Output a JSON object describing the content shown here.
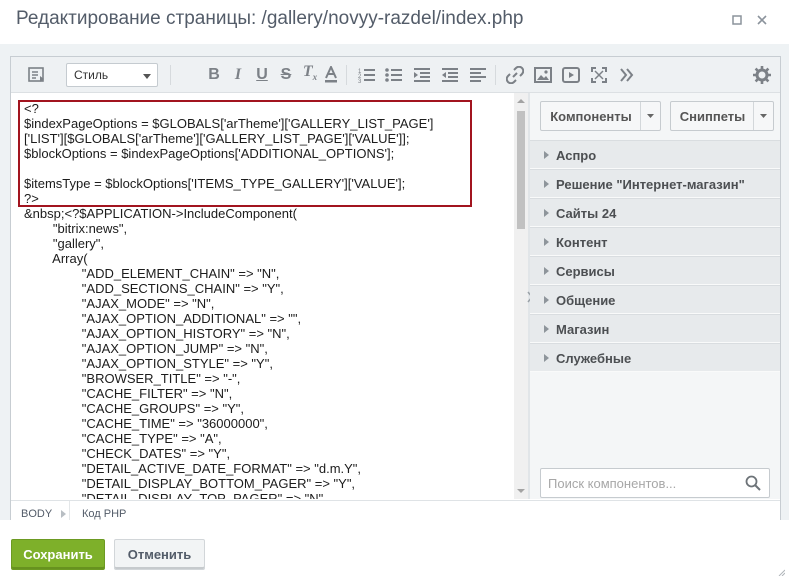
{
  "window": {
    "title": "Редактирование страницы: /gallery/novyy-razdel/index.php"
  },
  "toolbar": {
    "style_select": "Стиль",
    "icons": [
      "source-mode-icon",
      "bold-icon",
      "italic-icon",
      "underline-icon",
      "strikethrough-icon",
      "remove-format-icon",
      "font-color-icon",
      "ordered-list-icon",
      "unordered-list-icon",
      "indent-icon",
      "outdent-icon",
      "align-icon",
      "link-icon",
      "image-icon",
      "video-icon",
      "fullscreen-icon",
      "more-icon",
      "settings-icon"
    ]
  },
  "code": {
    "lines": [
      "<?",
      "$indexPageOptions = $GLOBALS['arTheme']['GALLERY_LIST_PAGE']",
      "['LIST'][$GLOBALS['arTheme']['GALLERY_LIST_PAGE']['VALUE']];",
      "$blockOptions = $indexPageOptions['ADDITIONAL_OPTIONS'];",
      "",
      "$itemsType = $blockOptions['ITEMS_TYPE_GALLERY']['VALUE'];",
      "?>",
      "&nbsp;<?$APPLICATION->IncludeComponent(",
      "        \"bitrix:news\",",
      "        \"gallery\",",
      "        Array(",
      "                \"ADD_ELEMENT_CHAIN\" => \"N\",",
      "                \"ADD_SECTIONS_CHAIN\" => \"Y\",",
      "                \"AJAX_MODE\" => \"N\",",
      "                \"AJAX_OPTION_ADDITIONAL\" => \"\",",
      "                \"AJAX_OPTION_HISTORY\" => \"N\",",
      "                \"AJAX_OPTION_JUMP\" => \"N\",",
      "                \"AJAX_OPTION_STYLE\" => \"Y\",",
      "                \"BROWSER_TITLE\" => \"-\",",
      "                \"CACHE_FILTER\" => \"N\",",
      "                \"CACHE_GROUPS\" => \"Y\",",
      "                \"CACHE_TIME\" => \"36000000\",",
      "                \"CACHE_TYPE\" => \"A\",",
      "                \"CHECK_DATES\" => \"Y\",",
      "                \"DETAIL_ACTIVE_DATE_FORMAT\" => \"d.m.Y\",",
      "                \"DETAIL_DISPLAY_BOTTOM_PAGER\" => \"Y\",",
      "                \"DETAIL_DISPLAY_TOP_PAGER\" => \"N\","
    ]
  },
  "sidebar": {
    "components_label": "Компоненты",
    "snippets_label": "Сниппеты",
    "groups": [
      "Аспро",
      "Решение \"Интернет-магазин\"",
      "Сайты 24",
      "Контент",
      "Сервисы",
      "Общение",
      "Магазин",
      "Служебные"
    ],
    "search_placeholder": "Поиск компонентов..."
  },
  "statusbar": {
    "crumb_body": "BODY",
    "crumb_php": "Код PHP"
  },
  "footer": {
    "save_label": "Сохранить",
    "cancel_label": "Отменить"
  },
  "colors": {
    "save_button": "#7eb02a",
    "highlight_border": "#a2141f"
  }
}
